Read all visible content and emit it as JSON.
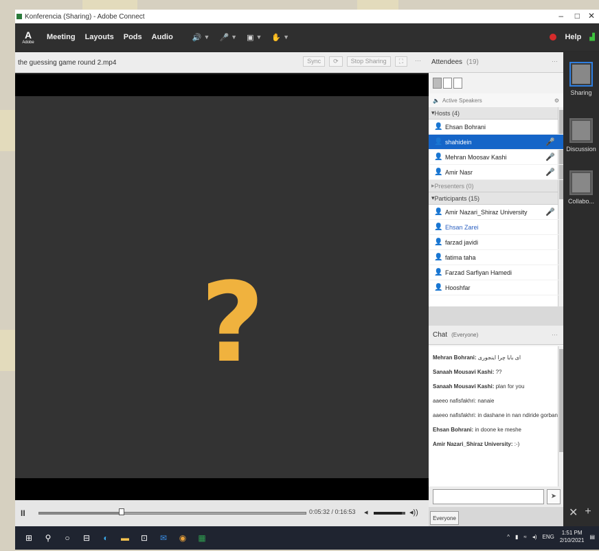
{
  "window": {
    "title": "Konferencia (Sharing) - Adobe Connect",
    "controls": [
      "–",
      "□",
      "✕"
    ]
  },
  "menubar": {
    "logo_text": "A",
    "logo_sub": "Adobe",
    "items": [
      "Meeting",
      "Layouts",
      "Pods",
      "Audio"
    ],
    "help_label": "Help",
    "icons": [
      "speaker-icon",
      "microphone-icon",
      "webcam-icon",
      "raise-hand-icon"
    ]
  },
  "share_pod": {
    "title": "the guessing game round 2.mp4",
    "header_controls": [
      "Sync",
      "⟳",
      "Stop Sharing",
      "⛶",
      "⋯"
    ],
    "center_glyph": "?",
    "center_color": "#f0b23e",
    "time_display": "0:05:32 / 0:16:53",
    "pause_label": "II",
    "progress": 0.31,
    "volume": 0.9
  },
  "attendees": {
    "title": "Attendees",
    "count": "(19)",
    "active_speakers_label": "Active Speakers",
    "groups": [
      {
        "label": "Hosts (4)",
        "muted": false,
        "rows": [
          {
            "name": "Ehsan Bohrani",
            "selected": false,
            "mic": false,
            "link": false
          },
          {
            "name": "shahidein",
            "selected": true,
            "mic": true,
            "link": false
          },
          {
            "name": "Mehran Moosav Kashi",
            "selected": false,
            "mic": true,
            "link": false
          },
          {
            "name": "Amir Nasr",
            "selected": false,
            "mic": true,
            "link": false
          }
        ]
      },
      {
        "label": "Presenters (0)",
        "muted": true,
        "rows": []
      },
      {
        "label": "Participants (15)",
        "muted": false,
        "rows": [
          {
            "name": "Amir Nazari_Shiraz University",
            "selected": false,
            "mic": true,
            "link": false
          },
          {
            "name": "Ehsan Zarei",
            "selected": false,
            "mic": false,
            "link": true
          },
          {
            "name": "farzad javidi",
            "selected": false,
            "mic": false,
            "link": false
          },
          {
            "name": "fatima taha",
            "selected": false,
            "mic": false,
            "link": false
          },
          {
            "name": "Farzad Sarfiyan Hamedi",
            "selected": false,
            "mic": false,
            "link": false
          },
          {
            "name": "Hooshfar",
            "selected": false,
            "mic": false,
            "link": false
          }
        ]
      }
    ]
  },
  "chat": {
    "title": "Chat",
    "scope": "(Everyone)",
    "messages": [
      {
        "sender": "Mehran Bohrani:",
        "text": "ای بابا چرا اینجوری"
      },
      {
        "sender": "Sanaah Mousavi Kashi:",
        "text": "??"
      },
      {
        "sender": "Sanaah Mousavi Kashi:",
        "text": "plan for you"
      },
      {
        "sender": "",
        "text": "aaeeo nafisfakhri: nanaie"
      },
      {
        "sender": "",
        "text": "aaeeo nafisfakhri: in dashane in nan ndiride gorban"
      },
      {
        "sender": "Ehsan Bohrani:",
        "text": "in doone ke meshe"
      },
      {
        "sender": "Amir Nazari_Shiraz University:",
        "text": ":-)"
      }
    ],
    "input_placeholder": "",
    "send_icon": "send-icon",
    "tab_label": "Everyone"
  },
  "layouts_sidebar": {
    "items": [
      {
        "label": "Sharing",
        "active": true
      },
      {
        "label": "Discussion",
        "active": false
      },
      {
        "label": "Collabo...",
        "active": false
      }
    ]
  },
  "taskbar": {
    "clock_time": "1:51 PM",
    "clock_date": "2/10/2021",
    "lang": "ENG",
    "icons": [
      "windows-start-icon",
      "search-icon",
      "task-view-icon",
      "widgets-icon",
      "edge-icon",
      "file-explorer-icon",
      "store-icon",
      "mail-icon",
      "chrome-icon",
      "excel-icon"
    ]
  }
}
